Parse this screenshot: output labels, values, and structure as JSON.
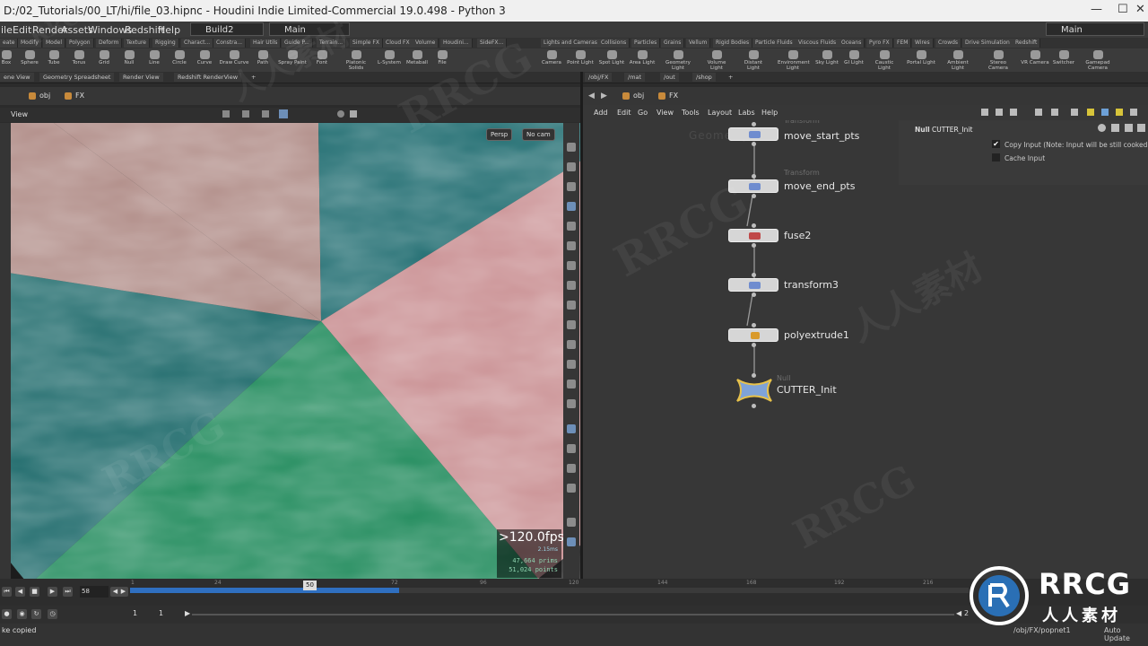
{
  "window": {
    "title": "D:/02_Tutorials/00_LT/hi/file_03.hipnc - Houdini Indie Limited-Commercial 19.0.498 - Python 3",
    "minimize": "—",
    "maximize": "☐",
    "close": "✕"
  },
  "menubar": {
    "items": [
      "ile",
      "Edit",
      "Render",
      "Assets",
      "Windows",
      "Redshift",
      "Help"
    ],
    "desktop": "Build2",
    "context": "Main",
    "right_context": "Main"
  },
  "shelf_left": {
    "tabs": [
      "eate",
      "Modify",
      "Model",
      "Polygon",
      "Deform",
      "Texture",
      "Rigging",
      "Charact...",
      "Constra...",
      "Hair Utils",
      "Guide P...",
      "Terrain...",
      "Simple FX",
      "Cloud FX",
      "Volume",
      "Houdini...",
      "SideFX..."
    ],
    "tools": [
      "Box",
      "Sphere",
      "Tube",
      "Torus",
      "Grid",
      "Null",
      "Line",
      "Circle",
      "Curve",
      "Draw Curve",
      "Path",
      "Spray Paint",
      "Font",
      "Platonic Solids",
      "L-System",
      "Metaball",
      "File"
    ]
  },
  "shelf_right": {
    "tabs": [
      "Lights and Cameras",
      "Collisions",
      "Particles",
      "Grains",
      "Vellum",
      "Rigid Bodies",
      "Particle Fluids",
      "Viscous Fluids",
      "Oceans",
      "Pyro FX",
      "FEM",
      "Wires",
      "Crowds",
      "Drive Simulation",
      "Redshift"
    ],
    "tools": [
      "Camera",
      "Point Light",
      "Spot Light",
      "Area Light",
      "Geometry Light",
      "Volume Light",
      "Distant Light",
      "Environment Light",
      "Sky Light",
      "GI Light",
      "Caustic Light",
      "Portal Light",
      "Ambient Light",
      "Stereo Camera",
      "VR Camera",
      "Switcher",
      "Gamepad Camera"
    ]
  },
  "left_pane": {
    "tabs": [
      "ene View",
      "Geometry Spreadsheet",
      "Render View",
      "Redshift RenderView"
    ],
    "path": [
      "obj",
      "FX"
    ],
    "view_label": "View",
    "persp_button": "Persp",
    "cam_button": "No cam",
    "fps": ">120.0fps",
    "ms": "2.15ms",
    "prims": "47,664  prims",
    "points": "51,024  points"
  },
  "right_pane": {
    "tabs": [
      "/obj/FX",
      "/mat",
      "/out",
      "/shop"
    ],
    "path": [
      "obj",
      "FX"
    ],
    "menu": [
      "Add",
      "Edit",
      "Go",
      "View",
      "Tools",
      "Layout",
      "Labs",
      "Help"
    ],
    "bg_text": "Geometry"
  },
  "nodes": [
    {
      "name": "move_start_pts",
      "type": "Transform",
      "icon_color": "#6f8ccf"
    },
    {
      "name": "move_end_pts",
      "type": "Transform",
      "icon_color": "#6f8ccf"
    },
    {
      "name": "fuse2",
      "type": "",
      "icon_color": "#c04848"
    },
    {
      "name": "transform3",
      "type": "",
      "icon_color": "#6f8ccf"
    },
    {
      "name": "polyextrude1",
      "type": "",
      "icon_color": "#d99a2b"
    },
    {
      "name": "CUTTER_Init",
      "type": "Null",
      "icon_color": "#7fa3d8"
    }
  ],
  "param": {
    "type_label": "Null",
    "node_name": "CUTTER_Init",
    "copy_input_label": "Copy Input (Note: Input will be still cooked if di",
    "copy_input_checked": true,
    "cache_input_label": "Cache Input",
    "cache_input_checked": false
  },
  "timeline": {
    "current_frame": "58",
    "marker_frame": "50",
    "ticks": [
      "1",
      "24",
      "48",
      "72",
      "96",
      "120",
      "144",
      "168",
      "192",
      "216"
    ],
    "start": "1",
    "end": "1",
    "range_end": "2"
  },
  "status": {
    "message": "ke copied",
    "path": "/obj/FX/popnet1",
    "auto_update": "Auto Update"
  },
  "watermark": {
    "brand": "RRCG",
    "cn": "人人素材"
  },
  "colors": {
    "slice_pink": "#b08c87",
    "slice_teal": "#1f6c70",
    "slice_rose": "#c98f92",
    "slice_green": "#1f8a5b",
    "slice_dark_teal": "#1e6a6b",
    "selected_node": "#e8c24a"
  }
}
